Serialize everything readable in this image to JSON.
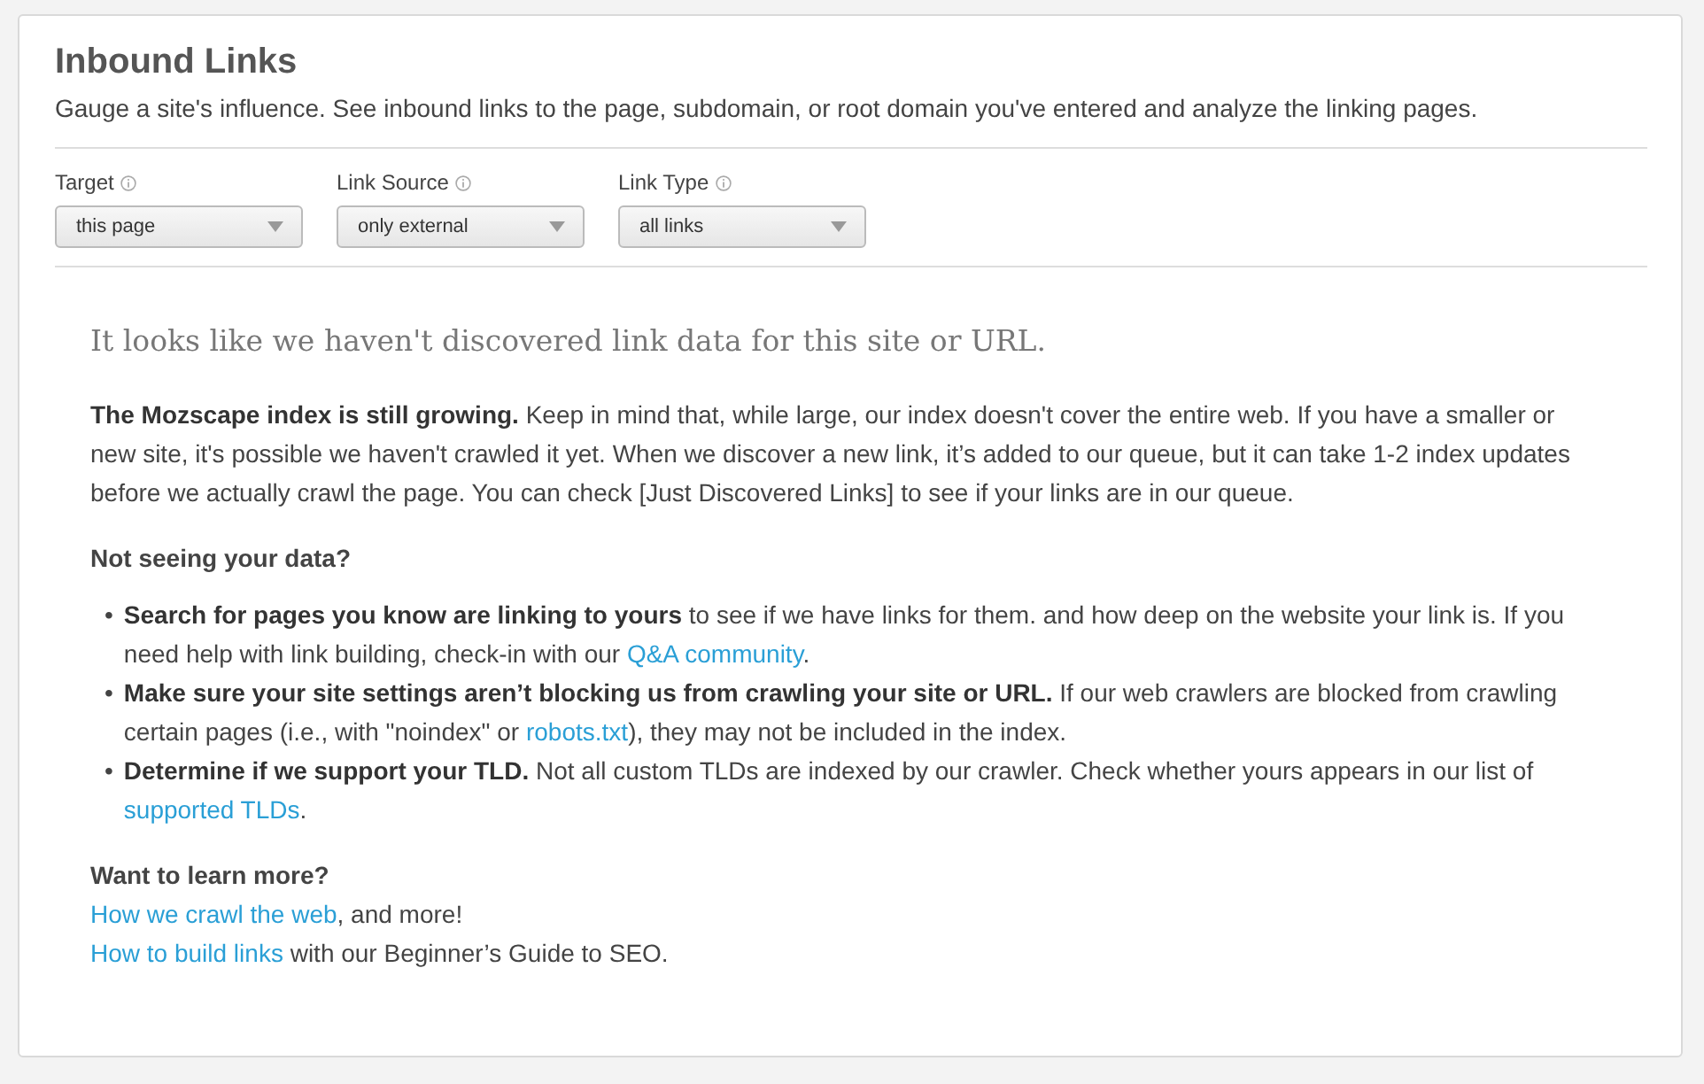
{
  "header": {
    "title": "Inbound Links",
    "subtitle": "Gauge a site's influence. See inbound links to the page, subdomain, or root domain you've entered and analyze the linking pages."
  },
  "filters": [
    {
      "label": "Target",
      "value": "this page"
    },
    {
      "label": "Link Source",
      "value": "only external"
    },
    {
      "label": "Link Type",
      "value": "all links"
    }
  ],
  "notice": {
    "heading": "It looks like we haven't discovered link data for this site or URL.",
    "intro": [
      {
        "kind": "text",
        "text": "**The Mozscape index is still growing.** Keep in mind that, while large, our index doesn't cover the entire web. If you have a smaller or new site, it's possible we haven't crawled it yet. When we discover a new link, it’s added to our queue, but it can take 1-2 index updates before we actually crawl the page. You can check [Just Discovered Links] to see if your links are in our queue."
      }
    ],
    "tips_heading": "Not seeing your data?",
    "tips": [
      {
        "bullet": "•",
        "parts": [
          {
            "kind": "text",
            "text": "**Search for pages you know are linking to yours** to see if we have links for them. and how deep on the website your link is. If you need help with link building, check-in with our "
          },
          {
            "kind": "link",
            "text": "Q&A community"
          },
          {
            "kind": "text",
            "text": "."
          }
        ]
      },
      {
        "bullet": "•",
        "parts": [
          {
            "kind": "text",
            "text": "**Make sure your site settings aren’t blocking us from crawling your site or URL.** If our web crawlers are blocked from crawling certain pages (i.e., with \"noindex\" or "
          },
          {
            "kind": "link",
            "text": "robots.txt"
          },
          {
            "kind": "text",
            "text": "), they may not be included in the index."
          }
        ]
      },
      {
        "bullet": "•",
        "parts": [
          {
            "kind": "text",
            "text": "**Determine if we support your TLD.** Not all custom TLDs are indexed by our crawler. Check whether yours appears in our list of "
          },
          {
            "kind": "link",
            "text": "supported TLDs"
          },
          {
            "kind": "text",
            "text": "."
          }
        ]
      }
    ],
    "more_heading": "Want to learn more?",
    "more": [
      [
        {
          "kind": "link",
          "text": "How we crawl the web"
        },
        {
          "kind": "text",
          "text": ", and more!"
        }
      ],
      [
        {
          "kind": "link",
          "text": "How to build links"
        },
        {
          "kind": "text",
          "text": " with our Beginner’s Guide to SEO."
        }
      ]
    ]
  }
}
